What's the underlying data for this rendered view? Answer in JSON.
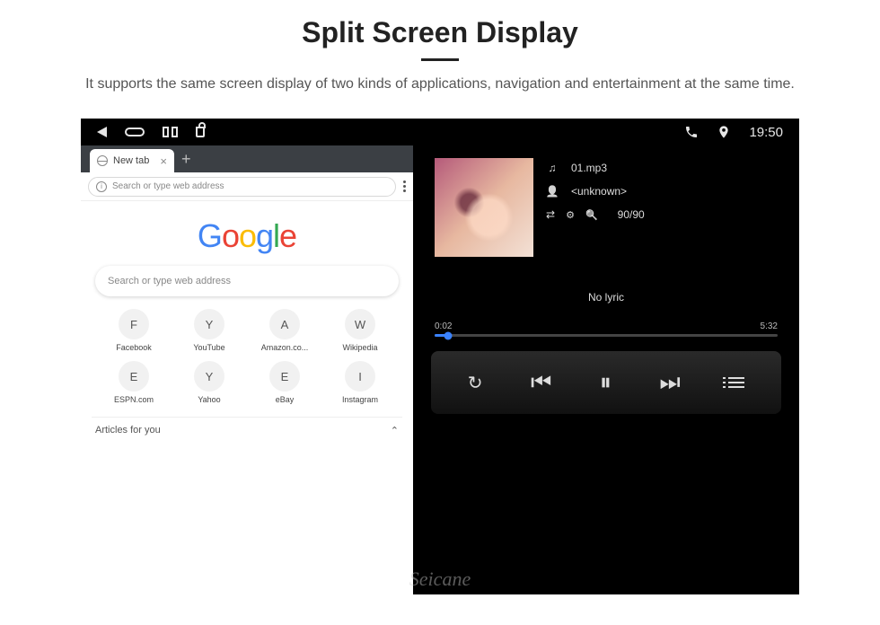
{
  "header": {
    "title": "Split Screen Display",
    "subtitle": "It supports the same screen display of two kinds of applications, navigation and entertainment at the same time."
  },
  "sysbar": {
    "clock": "19:50"
  },
  "browser": {
    "tab_label": "New tab",
    "url_placeholder": "Search or type web address",
    "search_placeholder": "Search or type web address",
    "logo": [
      "G",
      "o",
      "o",
      "g",
      "l",
      "e"
    ],
    "sites": [
      {
        "ic": "F",
        "label": "Facebook"
      },
      {
        "ic": "Y",
        "label": "YouTube"
      },
      {
        "ic": "A",
        "label": "Amazon.co..."
      },
      {
        "ic": "W",
        "label": "Wikipedia"
      },
      {
        "ic": "E",
        "label": "ESPN.com"
      },
      {
        "ic": "Y",
        "label": "Yahoo"
      },
      {
        "ic": "E",
        "label": "eBay"
      },
      {
        "ic": "I",
        "label": "Instagram"
      }
    ],
    "articles_label": "Articles for you"
  },
  "player": {
    "track": "01.mp3",
    "artist": "<unknown>",
    "counter": "90/90",
    "nolyric": "No lyric",
    "time_cur": "0:02",
    "time_tot": "5:32"
  },
  "watermark": "Seicane"
}
